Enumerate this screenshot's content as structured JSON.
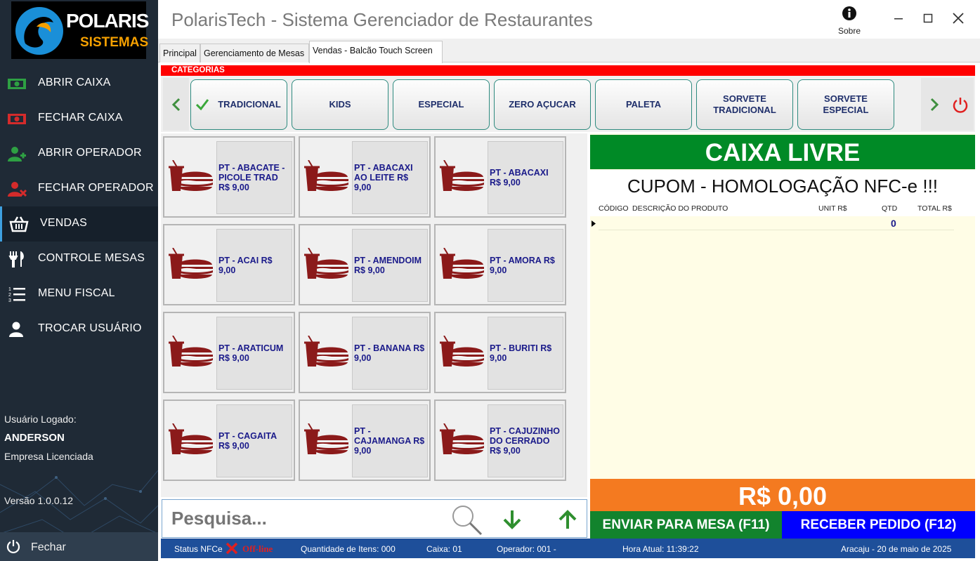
{
  "window": {
    "title": "PolarisTech - Sistema Gerenciador de Restaurantes",
    "about_label": "Sobre"
  },
  "logo": {
    "line1": "POLARIS",
    "line2": "SISTEMAS"
  },
  "sidebar": {
    "items": [
      {
        "label": "ABRIR CAIXA",
        "icon": "cash-open-icon"
      },
      {
        "label": "FECHAR CAIXA",
        "icon": "cash-close-icon"
      },
      {
        "label": "ABRIR OPERADOR",
        "icon": "user-add-icon"
      },
      {
        "label": "FECHAR OPERADOR",
        "icon": "user-remove-icon"
      },
      {
        "label": "VENDAS",
        "icon": "basket-icon"
      },
      {
        "label": "CONTROLE MESAS",
        "icon": "cutlery-icon"
      },
      {
        "label": "MENU FISCAL",
        "icon": "numbered-list-icon"
      },
      {
        "label": "TROCAR USUÁRIO",
        "icon": "user-icon"
      }
    ],
    "user_label": "Usuário Logado:",
    "user_name": "ANDERSON",
    "company": "Empresa Licenciada",
    "version": "Versão 1.0.0.12",
    "close_label": "Fechar"
  },
  "tabs": [
    {
      "label": "Principal"
    },
    {
      "label": "Gerenciamento de Mesas"
    },
    {
      "label": "Vendas - Balcão Touch Screen"
    }
  ],
  "categories_title": "CATEGORIAS",
  "categories": [
    {
      "label": "TRADICIONAL"
    },
    {
      "label": "KIDS"
    },
    {
      "label": "ESPECIAL"
    },
    {
      "label": "ZERO AÇUCAR"
    },
    {
      "label": "PALETA"
    },
    {
      "label": "SORVETE TRADICIONAL"
    },
    {
      "label": "SORVETE ESPECIAL"
    }
  ],
  "products": [
    {
      "label": "PT - ABACATE - PICOLE TRAD R$ 9,00"
    },
    {
      "label": "PT - ABACAXI AO LEITE R$ 9,00"
    },
    {
      "label": "PT - ABACAXI R$ 9,00"
    },
    {
      "label": "PT - ACAI R$ 9,00"
    },
    {
      "label": "PT - AMENDOIM R$ 9,00"
    },
    {
      "label": "PT - AMORA R$ 9,00"
    },
    {
      "label": "PT - ARATICUM R$ 9,00"
    },
    {
      "label": "PT - BANANA R$ 9,00"
    },
    {
      "label": "PT - BURITI R$ 9,00"
    },
    {
      "label": "PT - CAGAITA R$ 9,00"
    },
    {
      "label": "PT - CAJAMANGA R$ 9,00"
    },
    {
      "label": "PT - CAJUZINHO DO CERRADO R$ 9,00"
    }
  ],
  "search": {
    "placeholder": "Pesquisa..."
  },
  "order": {
    "status": "CAIXA LIVRE",
    "coupon": "CUPOM - HOMOLOGAÇÃO NFC-e !!!",
    "columns": [
      "CÓDIGO",
      "DESCRIÇÃO DO PRODUTO",
      "UNIT R$",
      "QTD",
      "TOTAL R$"
    ],
    "rows": [
      {
        "qty": "0"
      }
    ],
    "total": "R$ 0,00",
    "send_button": "ENVIAR PARA MESA (F11)",
    "receive_button": "RECEBER PEDIDO (F12)"
  },
  "statusbar": {
    "nfce_label": "Status NFCe",
    "nfce_status": "Off-line",
    "items_label": "Quantidade de Itens:  000",
    "caixa_label": "Caixa:  01",
    "operador_label": "Operador:  001 -",
    "hora_label": "Hora Atual:  11:39:22",
    "date_label": "Aracaju - 20 de maio de 2025"
  },
  "colors": {
    "sidebar": "#1f2a36",
    "category_bar": "#ff0000",
    "caixa_livre": "#008a26",
    "total_bg": "#f47a20",
    "send_bg": "#12832d",
    "receive_bg": "#0000ff",
    "statusbar": "#1e4f9a"
  }
}
